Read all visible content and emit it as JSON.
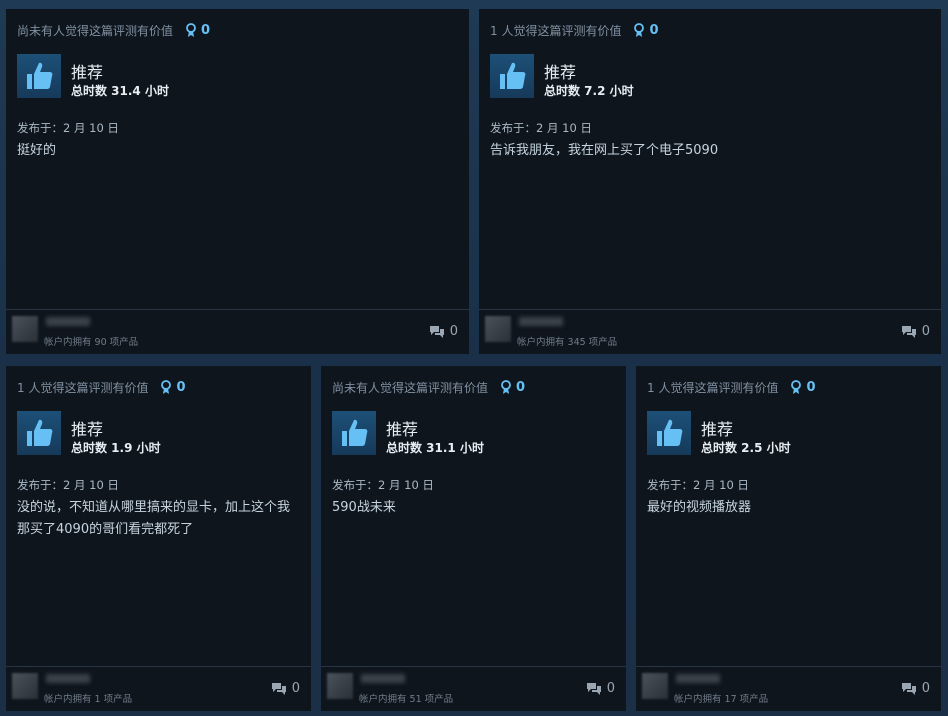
{
  "reviews": [
    {
      "helpful": "尚未有人觉得这篇评测有价值",
      "awards": "0",
      "verdict": "推荐",
      "hours": "总时数 31.4 小时",
      "posted": "发布于：2 月 10 日",
      "text": "挺好的",
      "owned": "帐户内拥有 90 项产品",
      "comments": "0"
    },
    {
      "helpful": "1 人觉得这篇评测有价值",
      "awards": "0",
      "verdict": "推荐",
      "hours": "总时数 7.2 小时",
      "posted": "发布于：2 月 10 日",
      "text": "告诉我朋友，我在网上买了个电子5090",
      "owned": "帐户内拥有 345 项产品",
      "comments": "0"
    },
    {
      "helpful": "1 人觉得这篇评测有价值",
      "awards": "0",
      "verdict": "推荐",
      "hours": "总时数 1.9 小时",
      "posted": "发布于：2 月 10 日",
      "text": "没的说，不知道从哪里搞来的显卡，加上这个我那买了4090的哥们看完都死了",
      "owned": "帐户内拥有 1 项产品",
      "comments": "0"
    },
    {
      "helpful": "尚未有人觉得这篇评测有价值",
      "awards": "0",
      "verdict": "推荐",
      "hours": "总时数 31.1 小时",
      "posted": "发布于：2 月 10 日",
      "text": "590战未来",
      "owned": "帐户内拥有 51 项产品",
      "comments": "0"
    },
    {
      "helpful": "1 人觉得这篇评测有价值",
      "awards": "0",
      "verdict": "推荐",
      "hours": "总时数 2.5 小时",
      "posted": "发布于：2 月 10 日",
      "text": "最好的视频播放器",
      "owned": "帐户内拥有 17 项产品",
      "comments": "0"
    }
  ],
  "icons": {
    "thumb": "thumbs-up-icon",
    "award": "award-ribbon-icon",
    "comment": "comment-bubbles-icon"
  },
  "colors": {
    "accent": "#66c0f4",
    "card_bg": "#0f151d",
    "thumb_bg": "#1d4f77"
  }
}
